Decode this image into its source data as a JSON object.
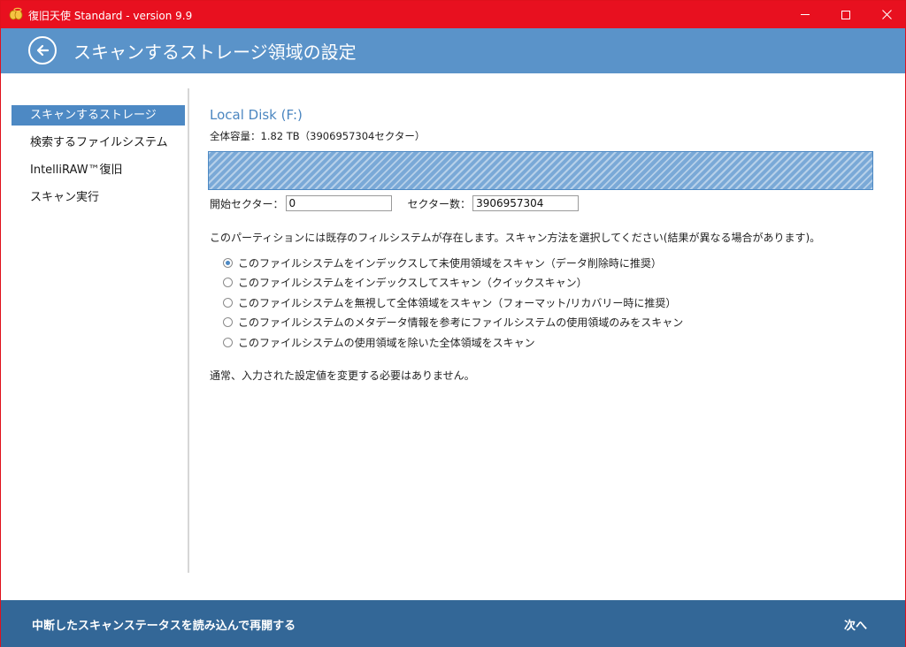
{
  "window": {
    "title": "復旧天使 Standard - version 9.9"
  },
  "header": {
    "title": "スキャンするストレージ領域の設定"
  },
  "sidebar": {
    "items": [
      {
        "label": "スキャンするストレージ",
        "active": true
      },
      {
        "label": "検索するファイルシステム",
        "active": false
      },
      {
        "label": "IntelliRAW™復旧",
        "active": false
      },
      {
        "label": "スキャン実行",
        "active": false
      }
    ]
  },
  "main": {
    "disk_title": "Local Disk (F:)",
    "capacity": "全体容量：1.82 TB（3906957304セクター）",
    "start_sector_label": "開始セクター：",
    "start_sector_value": "0",
    "sector_count_label": "セクター数：",
    "sector_count_value": "3906957304",
    "description": "このパーティションには既存のフィルシステムが存在します。スキャン方法を選択してください(結果が異なる場合があります)。",
    "options": [
      {
        "label": "このファイルシステムをインデックスして未使用領域をスキャン（データ削除時に推奨）",
        "checked": true
      },
      {
        "label": "このファイルシステムをインデックスしてスキャン（クイックスキャン）",
        "checked": false
      },
      {
        "label": "このファイルシステムを無視して全体領域をスキャン（フォーマット/リカバリー時に推奨）",
        "checked": false
      },
      {
        "label": "このファイルシステムのメタデータ情報を参考にファイルシステムの使用領域のみをスキャン",
        "checked": false
      },
      {
        "label": "このファイルシステムの使用領域を除いた全体領域をスキャン",
        "checked": false
      }
    ],
    "note": "通常、入力された設定値を変更する必要はありません。"
  },
  "footer": {
    "resume_label": "中断したスキャンステータスを読み込んで再開する",
    "next_label": "次へ"
  },
  "colors": {
    "titlebar": "#e8101f",
    "header": "#5a93c9",
    "accent": "#4d89c4",
    "footer": "#336797"
  },
  "icons": {
    "app": "angel-app-icon",
    "back": "back-arrow-icon",
    "minimize": "minimize-icon",
    "maximize": "maximize-icon",
    "close": "close-icon"
  }
}
